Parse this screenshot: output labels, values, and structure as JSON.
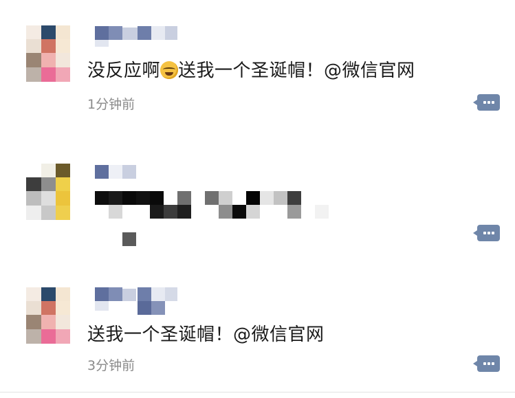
{
  "feed": {
    "posts": [
      {
        "text_before_emoji": "没反应啊",
        "emoji_icon": "laughing-crying-face-icon",
        "text_after_emoji": "送我一个圣诞帽！@微信官网",
        "timestamp": "1分钟前"
      },
      {
        "text": "",
        "timestamp": ""
      },
      {
        "text": "送我一个圣诞帽！@微信官网",
        "timestamp": "3分钟前"
      }
    ]
  },
  "colors": {
    "comment_button": "#6f86a9",
    "timestamp": "#8a8a8a",
    "divider": "#e3e3e3"
  }
}
